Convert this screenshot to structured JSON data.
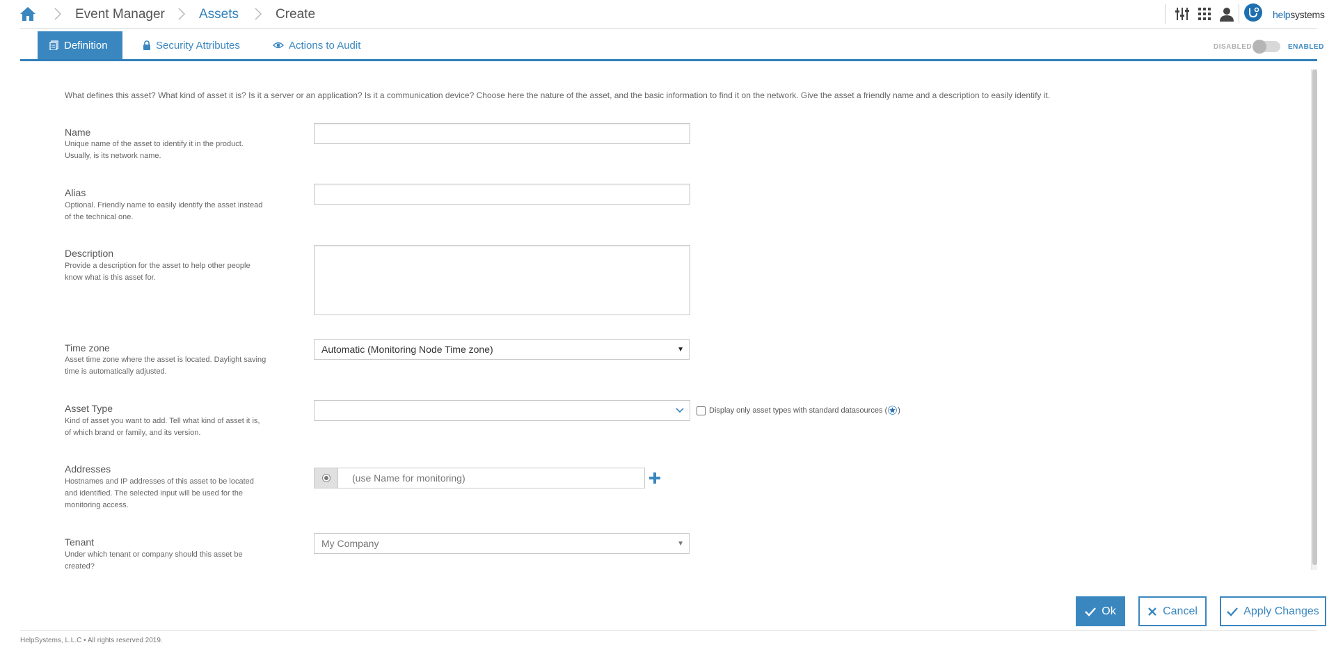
{
  "breadcrumb": {
    "items": [
      {
        "label": "Event Manager"
      },
      {
        "label": "Assets"
      },
      {
        "label": "Create"
      }
    ]
  },
  "header": {
    "icons": [
      "sliders-icon",
      "apps-grid-icon",
      "user-icon",
      "helpsystems-logo-icon"
    ],
    "logo": {
      "part1": "help",
      "part2": "systems"
    }
  },
  "tabs": [
    {
      "label": "Definition",
      "icon": "document-icon",
      "active": true
    },
    {
      "label": "Security Attributes",
      "icon": "lock-icon",
      "active": false
    },
    {
      "label": "Actions to Audit",
      "icon": "eye-icon",
      "active": false
    }
  ],
  "status_toggle": {
    "off_label": "DISABLED",
    "on_label": "ENABLED"
  },
  "intro": "What defines this asset? What kind of asset it is? Is it a server or an application? Is it a communication device? Choose here the nature of the asset, and the basic information to find it on the network. Give the asset a friendly name and a description to easily identify it.",
  "fields": {
    "name": {
      "label": "Name",
      "help": "Unique name of the asset to identify it in the product. Usually, is its network name.",
      "value": ""
    },
    "alias": {
      "label": "Alias",
      "help": "Optional. Friendly name to easily identify the asset instead of the technical one.",
      "value": ""
    },
    "description": {
      "label": "Description",
      "help": "Provide a description for the asset to help other people know what is this asset for.",
      "value": ""
    },
    "timezone": {
      "label": "Time zone",
      "help": "Asset time zone where the asset is located. Daylight saving time is automatically adjusted.",
      "selected": "Automatic (Monitoring Node Time zone)"
    },
    "asset_type": {
      "label": "Asset Type",
      "help": "Kind of asset you want to add. Tell what kind of asset it is, of which brand or family, and its version.",
      "selected": "",
      "std_only_label_pre": "Display only asset types with standard datasources (",
      "std_only_label_post": ")"
    },
    "addresses": {
      "label": "Addresses",
      "help": "Hostnames and IP addresses of this asset to be located and identified. The selected input will be used for the monitoring access.",
      "placeholder": "(use Name for monitoring)"
    },
    "tenant": {
      "label": "Tenant",
      "help": "Under which tenant or company should this asset be created?",
      "selected": "My Company"
    }
  },
  "actions": {
    "ok": "Ok",
    "cancel": "Cancel",
    "apply": "Apply Changes"
  },
  "colors": {
    "accent": "#3a87c0",
    "logo": "#1e6fb0"
  },
  "footer": "HelpSystems, L.L.C • All rights reserved 2019."
}
